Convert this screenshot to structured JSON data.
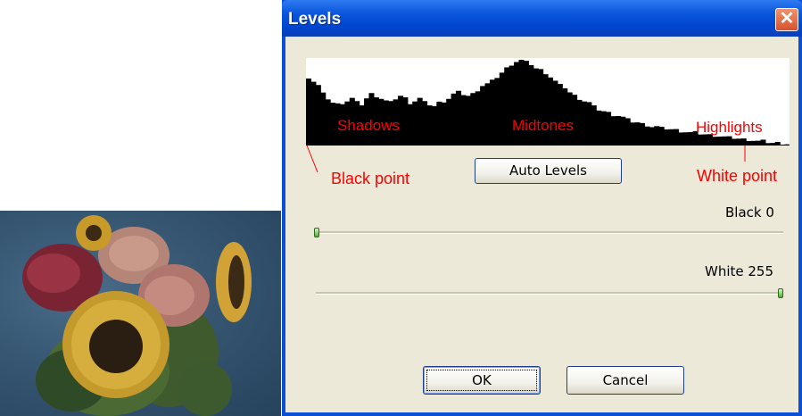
{
  "dialog": {
    "title": "Levels",
    "close_glyph": "✕",
    "histogram_labels": {
      "shadows": "Shadows",
      "midtones": "Midtones",
      "highlights": "Highlights"
    },
    "annotations": {
      "black_point": "Black point",
      "white_point": "White point"
    },
    "auto_levels_label": "Auto Levels",
    "black_slider": {
      "label": "Black 0",
      "value": 0,
      "min": 0,
      "max": 255
    },
    "white_slider": {
      "label": "White 255",
      "value": 255,
      "min": 0,
      "max": 255
    },
    "ok_label": "OK",
    "cancel_label": "Cancel"
  },
  "colors": {
    "annotation": "#ff0000",
    "title_bar": "#0146cf",
    "dialog_bg": "#ece9d8",
    "slider_thumb": "#4fae35"
  },
  "histogram": {
    "bin_heights": [
      0.8,
      0.75,
      0.7,
      0.6,
      0.55,
      0.5,
      0.48,
      0.5,
      0.52,
      0.55,
      0.5,
      0.48,
      0.55,
      0.6,
      0.58,
      0.55,
      0.52,
      0.5,
      0.55,
      0.58,
      0.55,
      0.5,
      0.52,
      0.55,
      0.5,
      0.48,
      0.46,
      0.5,
      0.52,
      0.55,
      0.6,
      0.62,
      0.6,
      0.58,
      0.6,
      0.65,
      0.7,
      0.72,
      0.75,
      0.8,
      0.85,
      0.9,
      0.95,
      0.98,
      1.0,
      0.97,
      0.95,
      0.9,
      0.88,
      0.85,
      0.8,
      0.75,
      0.7,
      0.68,
      0.62,
      0.58,
      0.55,
      0.52,
      0.5,
      0.45,
      0.42,
      0.4,
      0.38,
      0.36,
      0.35,
      0.33,
      0.3,
      0.28,
      0.27,
      0.25,
      0.24,
      0.22,
      0.22,
      0.2,
      0.2,
      0.19,
      0.18,
      0.17,
      0.16,
      0.15,
      0.15,
      0.14,
      0.13,
      0.12,
      0.12,
      0.11,
      0.1,
      0.09,
      0.09,
      0.08,
      0.07,
      0.07,
      0.06,
      0.05,
      0.05,
      0.04,
      0.03,
      0.03,
      0.02,
      0.02
    ]
  }
}
